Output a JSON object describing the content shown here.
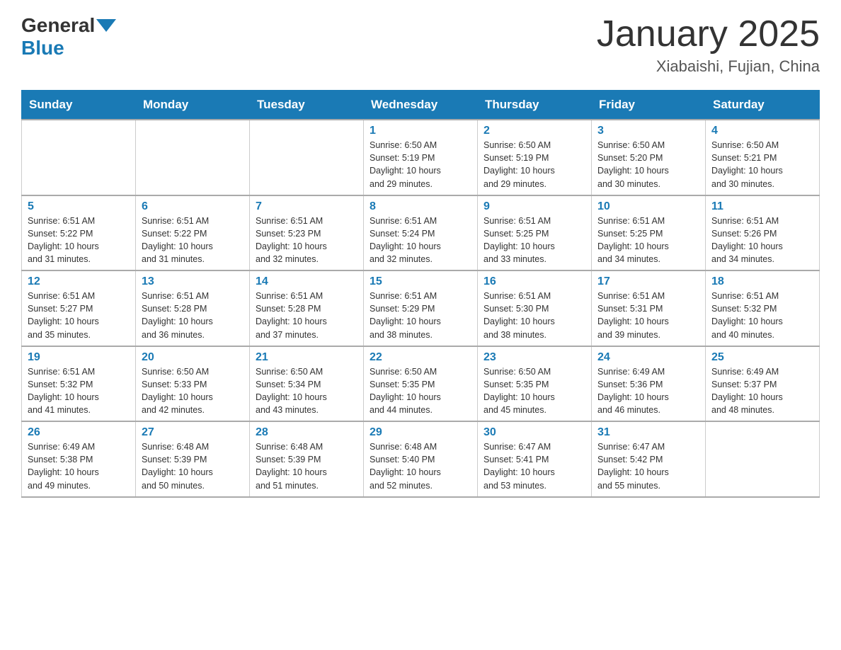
{
  "header": {
    "logo_general": "General",
    "logo_blue": "Blue",
    "title": "January 2025",
    "location": "Xiabaishi, Fujian, China"
  },
  "days_of_week": [
    "Sunday",
    "Monday",
    "Tuesday",
    "Wednesday",
    "Thursday",
    "Friday",
    "Saturday"
  ],
  "weeks": [
    [
      {
        "day": "",
        "info": ""
      },
      {
        "day": "",
        "info": ""
      },
      {
        "day": "",
        "info": ""
      },
      {
        "day": "1",
        "info": "Sunrise: 6:50 AM\nSunset: 5:19 PM\nDaylight: 10 hours\nand 29 minutes."
      },
      {
        "day": "2",
        "info": "Sunrise: 6:50 AM\nSunset: 5:19 PM\nDaylight: 10 hours\nand 29 minutes."
      },
      {
        "day": "3",
        "info": "Sunrise: 6:50 AM\nSunset: 5:20 PM\nDaylight: 10 hours\nand 30 minutes."
      },
      {
        "day": "4",
        "info": "Sunrise: 6:50 AM\nSunset: 5:21 PM\nDaylight: 10 hours\nand 30 minutes."
      }
    ],
    [
      {
        "day": "5",
        "info": "Sunrise: 6:51 AM\nSunset: 5:22 PM\nDaylight: 10 hours\nand 31 minutes."
      },
      {
        "day": "6",
        "info": "Sunrise: 6:51 AM\nSunset: 5:22 PM\nDaylight: 10 hours\nand 31 minutes."
      },
      {
        "day": "7",
        "info": "Sunrise: 6:51 AM\nSunset: 5:23 PM\nDaylight: 10 hours\nand 32 minutes."
      },
      {
        "day": "8",
        "info": "Sunrise: 6:51 AM\nSunset: 5:24 PM\nDaylight: 10 hours\nand 32 minutes."
      },
      {
        "day": "9",
        "info": "Sunrise: 6:51 AM\nSunset: 5:25 PM\nDaylight: 10 hours\nand 33 minutes."
      },
      {
        "day": "10",
        "info": "Sunrise: 6:51 AM\nSunset: 5:25 PM\nDaylight: 10 hours\nand 34 minutes."
      },
      {
        "day": "11",
        "info": "Sunrise: 6:51 AM\nSunset: 5:26 PM\nDaylight: 10 hours\nand 34 minutes."
      }
    ],
    [
      {
        "day": "12",
        "info": "Sunrise: 6:51 AM\nSunset: 5:27 PM\nDaylight: 10 hours\nand 35 minutes."
      },
      {
        "day": "13",
        "info": "Sunrise: 6:51 AM\nSunset: 5:28 PM\nDaylight: 10 hours\nand 36 minutes."
      },
      {
        "day": "14",
        "info": "Sunrise: 6:51 AM\nSunset: 5:28 PM\nDaylight: 10 hours\nand 37 minutes."
      },
      {
        "day": "15",
        "info": "Sunrise: 6:51 AM\nSunset: 5:29 PM\nDaylight: 10 hours\nand 38 minutes."
      },
      {
        "day": "16",
        "info": "Sunrise: 6:51 AM\nSunset: 5:30 PM\nDaylight: 10 hours\nand 38 minutes."
      },
      {
        "day": "17",
        "info": "Sunrise: 6:51 AM\nSunset: 5:31 PM\nDaylight: 10 hours\nand 39 minutes."
      },
      {
        "day": "18",
        "info": "Sunrise: 6:51 AM\nSunset: 5:32 PM\nDaylight: 10 hours\nand 40 minutes."
      }
    ],
    [
      {
        "day": "19",
        "info": "Sunrise: 6:51 AM\nSunset: 5:32 PM\nDaylight: 10 hours\nand 41 minutes."
      },
      {
        "day": "20",
        "info": "Sunrise: 6:50 AM\nSunset: 5:33 PM\nDaylight: 10 hours\nand 42 minutes."
      },
      {
        "day": "21",
        "info": "Sunrise: 6:50 AM\nSunset: 5:34 PM\nDaylight: 10 hours\nand 43 minutes."
      },
      {
        "day": "22",
        "info": "Sunrise: 6:50 AM\nSunset: 5:35 PM\nDaylight: 10 hours\nand 44 minutes."
      },
      {
        "day": "23",
        "info": "Sunrise: 6:50 AM\nSunset: 5:35 PM\nDaylight: 10 hours\nand 45 minutes."
      },
      {
        "day": "24",
        "info": "Sunrise: 6:49 AM\nSunset: 5:36 PM\nDaylight: 10 hours\nand 46 minutes."
      },
      {
        "day": "25",
        "info": "Sunrise: 6:49 AM\nSunset: 5:37 PM\nDaylight: 10 hours\nand 48 minutes."
      }
    ],
    [
      {
        "day": "26",
        "info": "Sunrise: 6:49 AM\nSunset: 5:38 PM\nDaylight: 10 hours\nand 49 minutes."
      },
      {
        "day": "27",
        "info": "Sunrise: 6:48 AM\nSunset: 5:39 PM\nDaylight: 10 hours\nand 50 minutes."
      },
      {
        "day": "28",
        "info": "Sunrise: 6:48 AM\nSunset: 5:39 PM\nDaylight: 10 hours\nand 51 minutes."
      },
      {
        "day": "29",
        "info": "Sunrise: 6:48 AM\nSunset: 5:40 PM\nDaylight: 10 hours\nand 52 minutes."
      },
      {
        "day": "30",
        "info": "Sunrise: 6:47 AM\nSunset: 5:41 PM\nDaylight: 10 hours\nand 53 minutes."
      },
      {
        "day": "31",
        "info": "Sunrise: 6:47 AM\nSunset: 5:42 PM\nDaylight: 10 hours\nand 55 minutes."
      },
      {
        "day": "",
        "info": ""
      }
    ]
  ]
}
